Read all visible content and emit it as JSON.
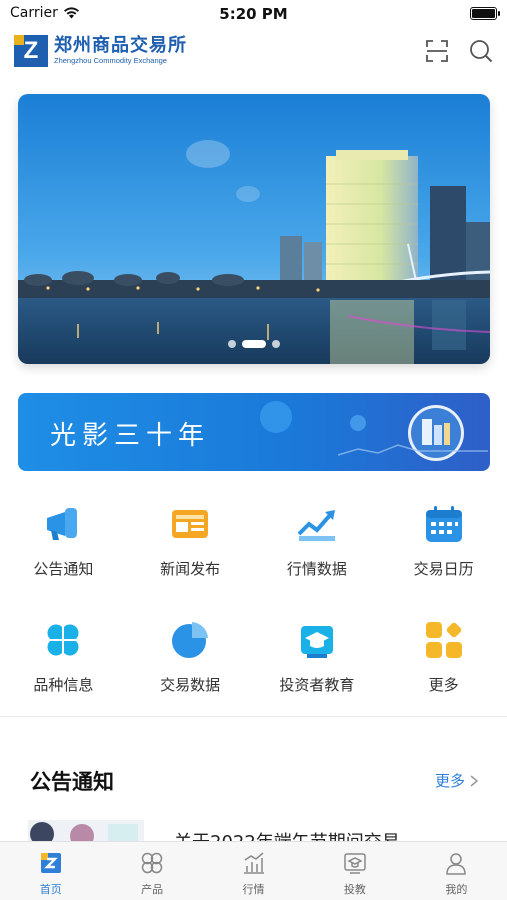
{
  "status_bar": {
    "carrier": "Carrier",
    "time": "5:20 PM"
  },
  "header": {
    "logo_cn": "郑州商品交易所",
    "logo_en": "Zhengzhou Commodity Exchange",
    "logo_letter": "Z"
  },
  "banner": {
    "slide_count": 3,
    "active_slide": 2
  },
  "promo": {
    "text": "光影三十年"
  },
  "grid": [
    {
      "label": "公告通知",
      "icon": "megaphone-icon"
    },
    {
      "label": "新闻发布",
      "icon": "newspaper-icon"
    },
    {
      "label": "行情数据",
      "icon": "trend-chart-icon"
    },
    {
      "label": "交易日历",
      "icon": "calendar-icon"
    },
    {
      "label": "品种信息",
      "icon": "four-petal-icon"
    },
    {
      "label": "交易数据",
      "icon": "pie-chart-icon"
    },
    {
      "label": "投资者教育",
      "icon": "graduation-cap-icon"
    },
    {
      "label": "更多",
      "icon": "more-apps-icon"
    }
  ],
  "announcements": {
    "title": "公告通知",
    "more_label": "更多",
    "first_item_title": "关于2022年端午节期间交易"
  },
  "tabbar": [
    {
      "label": "首页",
      "icon": "home-icon",
      "active": true
    },
    {
      "label": "产品",
      "icon": "products-icon",
      "active": false
    },
    {
      "label": "行情",
      "icon": "market-icon",
      "active": false
    },
    {
      "label": "投教",
      "icon": "education-icon",
      "active": false
    },
    {
      "label": "我的",
      "icon": "profile-icon",
      "active": false
    }
  ],
  "colors": {
    "brand_blue": "#1f5fb0",
    "brand_gold": "#e8b21c",
    "accent_blue": "#2f7fd8",
    "icon_blue": "#2b93e6",
    "icon_orange": "#f5a623",
    "icon_cyan": "#1ab0e8"
  }
}
